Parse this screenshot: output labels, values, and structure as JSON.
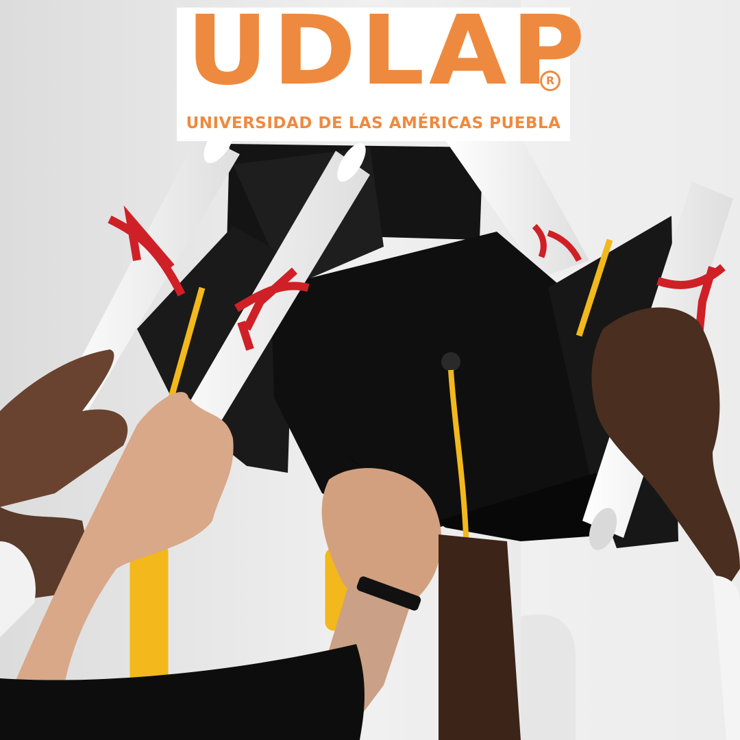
{
  "logo": {
    "wordmark": "UDLAP",
    "registered_mark": "R",
    "subtitle": "UNIVERSIDAD DE LAS AMÉRICAS PUEBLA",
    "color": "#ee8a3f"
  },
  "photo": {
    "subject": "graduation caps and rolled diplomas raised by hands",
    "icon": "graduation-photo",
    "colors": {
      "background": "#e8e8e8",
      "cap": "#111111",
      "tassel": "#f2b81c",
      "ribbon": "#cf2027",
      "diploma": "#f7f7f7",
      "skin_light": "#d8a889",
      "skin_dark": "#6a4330"
    }
  }
}
